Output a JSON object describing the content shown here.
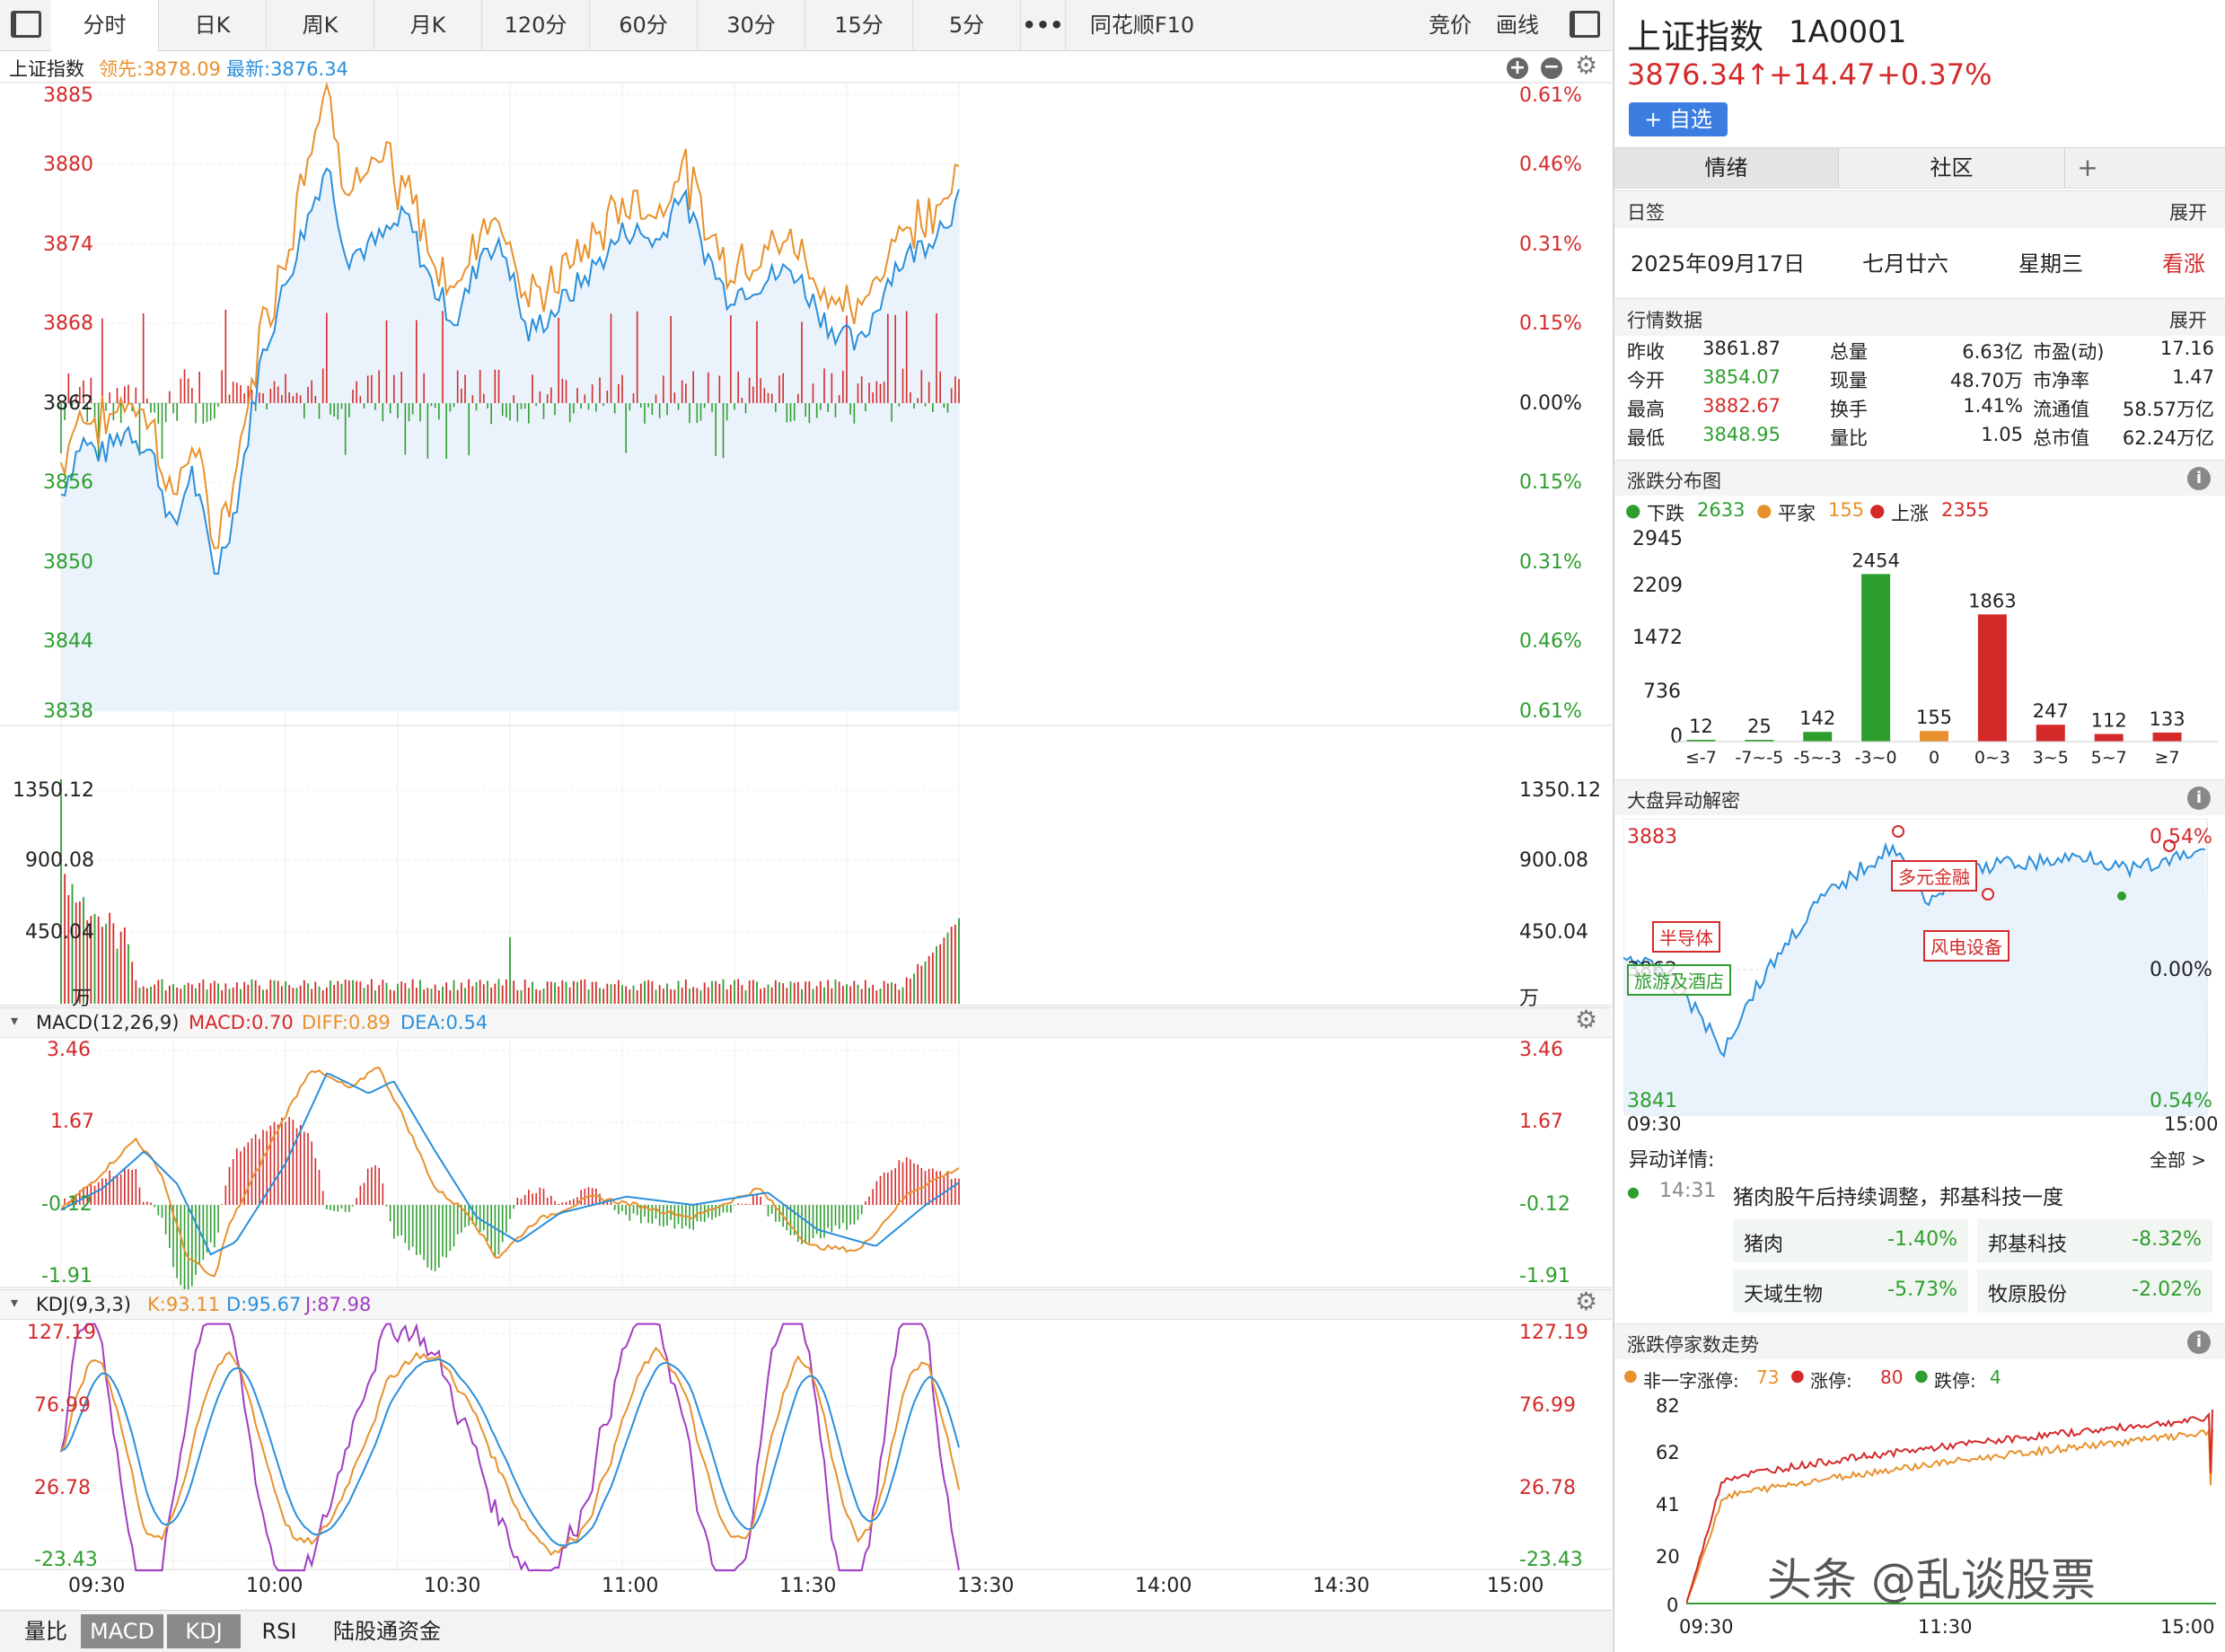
{
  "toolbar": {
    "tabs": [
      "分时",
      "日K",
      "周K",
      "月K",
      "120分",
      "60分",
      "30分",
      "15分",
      "5分",
      "•••",
      "同花顺F10"
    ],
    "active_tab": "分时",
    "right_buttons": [
      "竞价",
      "画线"
    ]
  },
  "price_chart": {
    "name": "上证指数",
    "leading_label": "领先:3878.09",
    "latest_label": "最新:3876.34",
    "left_axis": [
      "3885",
      "3880",
      "3874",
      "3868",
      "3862",
      "3856",
      "3850",
      "3844",
      "3838"
    ],
    "right_axis": [
      "0.61%",
      "0.46%",
      "0.31%",
      "0.15%",
      "0.00%",
      "0.15%",
      "0.31%",
      "0.46%",
      "0.61%"
    ]
  },
  "volume_chart": {
    "left_axis": [
      "1350.12",
      "900.08",
      "450.04",
      "万"
    ],
    "right_axis": [
      "1350.12",
      "900.08",
      "450.04",
      "万"
    ]
  },
  "macd": {
    "title": "MACD(12,26,9)",
    "macd_label": "MACD:0.70",
    "diff_label": "DIFF:0.89",
    "dea_label": "DEA:0.54",
    "axis": [
      "3.46",
      "1.67",
      "-0.12",
      "-1.91"
    ]
  },
  "kdj": {
    "title": "KDJ(9,3,3)",
    "k_label": "K:93.11",
    "d_label": "D:95.67",
    "j_label": "J:87.98",
    "axis": [
      "127.19",
      "76.99",
      "26.78",
      "-23.43"
    ]
  },
  "time_axis": [
    "09:30",
    "10:00",
    "10:30",
    "11:00",
    "11:30",
    "13:30",
    "14:00",
    "14:30",
    "15:00"
  ],
  "bottom_tabs": [
    "量比",
    "MACD",
    "KDJ",
    "RSI",
    "陆股通资金"
  ],
  "bottom_tabs_active": [
    "MACD",
    "KDJ"
  ],
  "header": {
    "name": "上证指数",
    "code": "1A0001",
    "price": "3876.34↑",
    "change": "+14.47",
    "change_pct": "+0.37%",
    "watch_button": "+ 自选"
  },
  "right_tabs": [
    "情绪",
    "社区",
    "+"
  ],
  "daily": {
    "section": "日签",
    "expand": "展开",
    "date": "2025年09月17日",
    "lunar": "七月廿六",
    "weekday": "星期三",
    "sentiment": "看涨"
  },
  "market_data": {
    "section": "行情数据",
    "expand": "展开",
    "rows": [
      {
        "l1": "昨收",
        "v1": "3861.87",
        "l2": "总量",
        "v2": "6.63亿",
        "l3": "市盈(动)",
        "v3": "17.16"
      },
      {
        "l1": "今开",
        "v1": "3854.07",
        "l2": "现量",
        "v2": "48.70万",
        "l3": "市净率",
        "v3": "1.47"
      },
      {
        "l1": "最高",
        "v1": "3882.67",
        "l2": "换手",
        "v2": "1.41%",
        "l3": "流通值",
        "v3": "58.57万亿"
      },
      {
        "l1": "最低",
        "v1": "3848.95",
        "l2": "量比",
        "v2": "1.05",
        "l3": "总市值",
        "v3": "62.24万亿"
      }
    ]
  },
  "distribution": {
    "section": "涨跌分布图",
    "legend_down": "下跌",
    "legend_down_value": "2633",
    "legend_flat": "平家",
    "legend_flat_value": "155",
    "legend_up": "上涨",
    "legend_up_value": "2355",
    "y_axis": [
      "2945",
      "2209",
      "1472",
      "736",
      "0"
    ]
  },
  "chart_data": {
    "type": "bar",
    "categories": [
      "≤-7",
      "-7~-5",
      "-5~-3",
      "-3~0",
      "0",
      "0~3",
      "3~5",
      "5~7",
      "≥7"
    ],
    "values": [
      12,
      25,
      142,
      2454,
      155,
      1863,
      247,
      112,
      133
    ],
    "colors": [
      "#2e9e2e",
      "#2e9e2e",
      "#2e9e2e",
      "#2e9e2e",
      "#e8912c",
      "#d42a2a",
      "#d42a2a",
      "#d42a2a",
      "#d42a2a"
    ],
    "ylim": [
      0,
      2945
    ]
  },
  "anomaly": {
    "section": "大盘异动解密",
    "top_left": "3883",
    "top_right": "0.54%",
    "mid_left": "3862",
    "mid_right": "0.00%",
    "bottom_left": "3841",
    "bottom_right": "0.54%",
    "time_start": "09:30",
    "time_end": "15:00",
    "tags": [
      "多元金融",
      "半导体",
      "风电设备",
      "旅游及酒店"
    ]
  },
  "anomaly_detail": {
    "title": "异动详情:",
    "all": "全部 >",
    "time": "14:31",
    "text": "猪肉股午后持续调整，邦基科技一度",
    "items": [
      {
        "name": "猪肉",
        "value": "-1.40%"
      },
      {
        "name": "邦基科技",
        "value": "-8.32%"
      },
      {
        "name": "天域生物",
        "value": "-5.73%"
      },
      {
        "name": "牧原股份",
        "value": "-2.02%"
      }
    ]
  },
  "limit": {
    "section": "涨跌停家数走势",
    "legend1": "非一字涨停:",
    "legend1_value": "73",
    "legend2": "涨停:",
    "legend2_value": "80",
    "legend3": "跌停:",
    "legend3_value": "4",
    "y_axis": [
      "82",
      "62",
      "41",
      "20",
      "0"
    ],
    "x_axis": [
      "09:30",
      "11:30",
      "15:00"
    ]
  },
  "watermark": "头条 @乱谈股票",
  "colors": {
    "up": "#d42a2a",
    "down": "#2e9e2e",
    "flat": "#e8912c",
    "line_blue": "#2a8fdb",
    "line_orange": "#e8912c",
    "line_purple": "#a03cc2"
  }
}
